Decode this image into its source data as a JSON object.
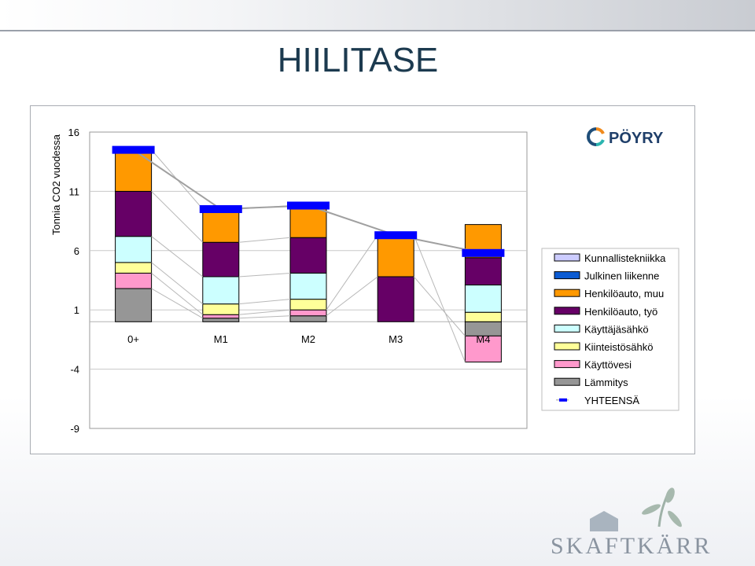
{
  "slide": {
    "title": "HIILITASE"
  },
  "logos": {
    "poyry": "PÖYRY",
    "skaftkarr": "SKAFTKÄRR"
  },
  "colors": {
    "Kunnallistekniikka": "#ccccff",
    "Julkinen liikenne": "#0b5bd3",
    "Henkilöauto, muu": "#ff9900",
    "Henkilöauto, työ": "#660066",
    "Käyttäjäsähkö": "#ccffff",
    "Kiinteistösähkö": "#ffff99",
    "Käyttövesi": "#ff99cc",
    "Lämmitys": "#969696",
    "YHTEENSÄ": "#0000ff"
  },
  "chart_data": {
    "type": "bar",
    "stacked": true,
    "title": "",
    "ylabel": "Tonnia CO2 vuodessa",
    "xlabel": "",
    "ylim": [
      -9,
      16
    ],
    "yticks": [
      16,
      11,
      6,
      1,
      -4,
      -9
    ],
    "grid": true,
    "legend": "right",
    "categories": [
      "0+",
      "M1",
      "M2",
      "M3",
      "M4"
    ],
    "series": [
      {
        "name": "Kunnallistekniikka",
        "values": [
          0,
          0,
          0,
          0,
          0
        ]
      },
      {
        "name": "Julkinen liikenne",
        "values": [
          0,
          0,
          0,
          0,
          0
        ]
      },
      {
        "name": "Henkilöauto, muu",
        "values": [
          3.5,
          2.8,
          2.7,
          3.5,
          2.8
        ]
      },
      {
        "name": "Henkilöauto, työ",
        "values": [
          3.8,
          2.9,
          3.0,
          3.8,
          2.3
        ]
      },
      {
        "name": "Käyttäjäsähkö",
        "values": [
          2.2,
          2.3,
          2.2,
          0,
          2.3
        ]
      },
      {
        "name": "Kiinteistösähkö",
        "values": [
          0.9,
          0.9,
          0.9,
          0,
          0.8
        ]
      },
      {
        "name": "Käyttövesi",
        "values": [
          1.3,
          0.3,
          0.5,
          0,
          -2.2
        ]
      },
      {
        "name": "Lämmitys",
        "values": [
          2.8,
          0.3,
          0.5,
          0,
          -1.2
        ]
      }
    ],
    "total": {
      "name": "YHTEENSÄ",
      "values": [
        14.5,
        9.5,
        9.8,
        7.3,
        5.8
      ]
    }
  }
}
